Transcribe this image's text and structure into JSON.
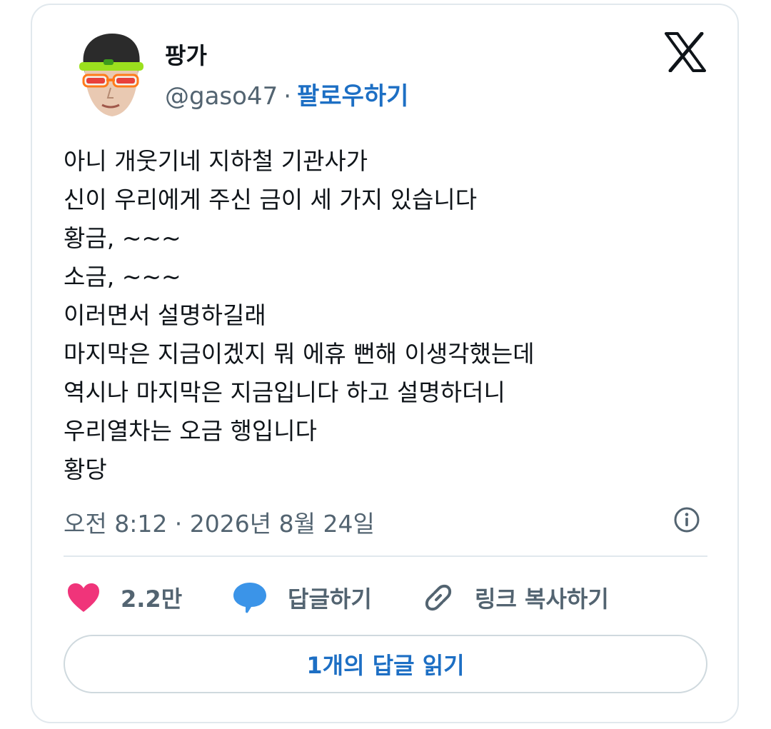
{
  "author": {
    "name": "팡가",
    "handle": "@gaso47",
    "separator": "·",
    "follow_label": "팔로우하기"
  },
  "tweet": {
    "lines": [
      "아니 개웃기네 지하철 기관사가",
      "신이 우리에게 주신 금이 세 가지 있습니다",
      "황금, ~~~",
      "소금, ~~~",
      "이러면서 설명하길래",
      "마지막은 지금이겠지 뭐 에휴 뻔해 이생각했는데",
      "역시나 마지막은 지금입니다 하고 설명하더니",
      "우리열차는 오금 행입니다",
      "황당"
    ],
    "timestamp": "오전 8:12 · 2026년 8월 24일"
  },
  "actions": {
    "like_count": "2.2만",
    "reply_label": "답글하기",
    "copy_link_label": "링크 복사하기"
  },
  "read_replies_label": "1개의 답글 읽기",
  "icons": {
    "logo": "x-logo-icon",
    "info": "info-icon",
    "like": "heart-icon",
    "reply": "speech-bubble-icon",
    "copy": "link-icon"
  },
  "colors": {
    "accent": "#1d6fc4",
    "heart": "#f0347a",
    "bubble": "#3b94e8",
    "muted": "#536471",
    "border": "#e1e8ed"
  }
}
